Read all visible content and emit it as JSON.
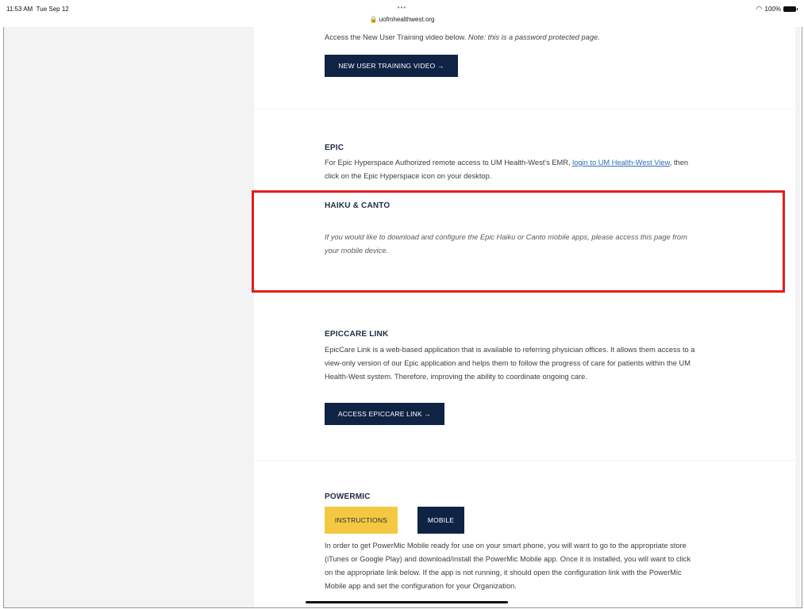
{
  "status_bar": {
    "time": "11:53 AM",
    "date": "Tue Sep 12",
    "dots": "•••",
    "url": "uofmhealthwest.org",
    "battery": "100%"
  },
  "sections": {
    "training": {
      "text_prefix": "Access the New User Training video below.",
      "text_note": "Note: this is a password protected page.",
      "button": "NEW USER TRAINING VIDEO →"
    },
    "epic": {
      "heading": "EPIC",
      "text_before": "For Epic Hyperspace Authorized remote access to UM Health-West's EMR,",
      "link": "login to UM Health-West View",
      "text_after": ", then",
      "text_line2": "click on the Epic Hyperspace icon on your desktop."
    },
    "haiku": {
      "heading": "HAIKU & CANTO",
      "line1": "If you would like to download and configure the Epic Haiku or Canto mobile apps, please access this page from",
      "line2": "your mobile device."
    },
    "epiccare": {
      "heading": "EPICCARE LINK",
      "line1": "EpicCare Link is a web-based application that is available to referring physician offices. It allows them access to a",
      "line2": "view-only version of our Epic application and helps them to follow the progress of care for patients within the UM",
      "line3": "Health-West system. Therefore, improving the ability to coordinate ongoing care.",
      "button": "ACCESS EPICCARE LINK →"
    },
    "powermic": {
      "heading": "POWERMIC",
      "btn_instructions": "INSTRUCTIONS",
      "btn_mobile": "MOBILE",
      "line1": "In order to get PowerMic Mobile ready for use on your smart phone, you will want to go to the appropriate store",
      "line2": "(iTunes or Google Play) and download/install the PowerMic Mobile app.  Once it is installed, you will want to click",
      "line3": "on the appropriate link below.  If the app is not running, it should open the configuration link with the PowerMic",
      "line4": "Mobile app and set the configuration for your Organization."
    }
  },
  "colors": {
    "navy_button": "#0f2345",
    "yellow_button": "#f5c842",
    "highlight": "#e41c1c",
    "link": "#2f6fb3"
  }
}
